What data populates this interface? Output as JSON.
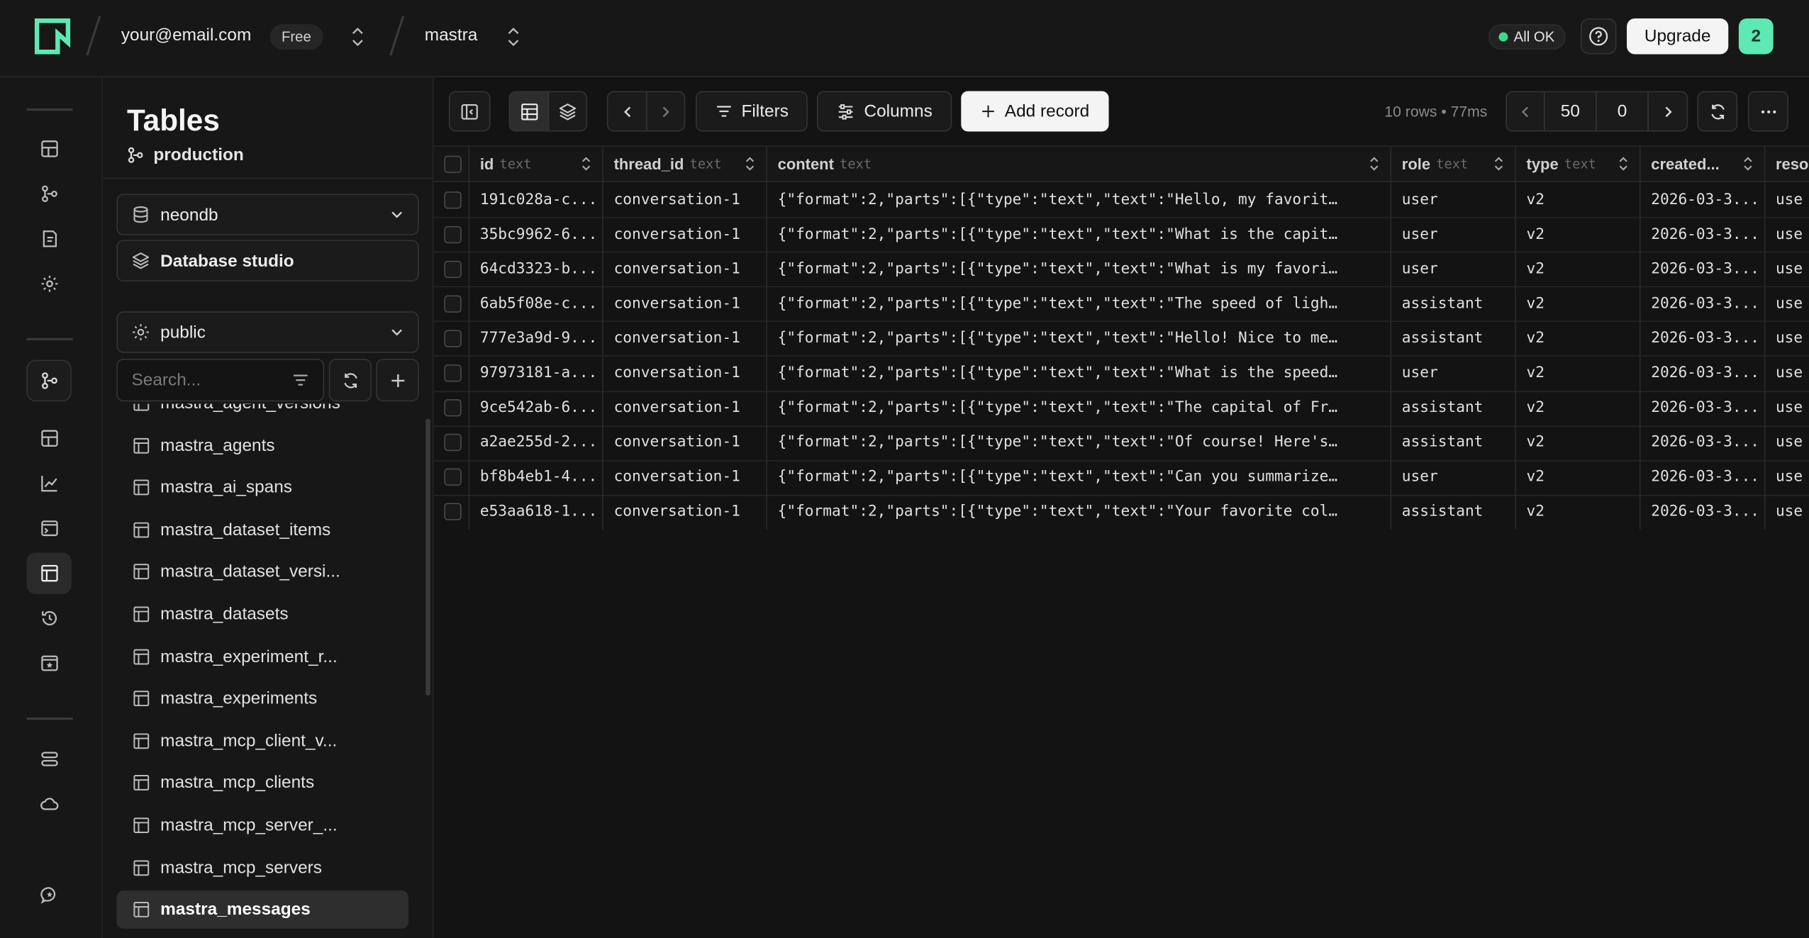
{
  "topbar": {
    "account": "your@email.com",
    "plan": "Free",
    "project": "mastra",
    "status": "All OK",
    "upgrade_label": "Upgrade",
    "notification_count": "2",
    "status_color": "#39d98a",
    "brand_color": "#5ee8b4"
  },
  "sidebar": {
    "title": "Tables",
    "branch": "production",
    "database": "neondb",
    "studio_label": "Database studio",
    "schema": "public",
    "search_placeholder": "Search...",
    "tables": [
      "mastra_agent_versions",
      "mastra_agents",
      "mastra_ai_spans",
      "mastra_dataset_items",
      "mastra_dataset_versi...",
      "mastra_datasets",
      "mastra_experiment_r...",
      "mastra_experiments",
      "mastra_mcp_client_v...",
      "mastra_mcp_clients",
      "mastra_mcp_server_...",
      "mastra_mcp_servers",
      "mastra_messages"
    ],
    "selected_table": "mastra_messages"
  },
  "toolbar": {
    "filters_label": "Filters",
    "columns_label": "Columns",
    "add_record_label": "Add record",
    "meta": "10 rows • 77ms",
    "limit": "50",
    "offset": "0"
  },
  "grid": {
    "columns": [
      {
        "name": "id",
        "type": "text"
      },
      {
        "name": "thread_id",
        "type": "text"
      },
      {
        "name": "content",
        "type": "text"
      },
      {
        "name": "role",
        "type": "text"
      },
      {
        "name": "type",
        "type": "text"
      },
      {
        "name": "created...",
        "type": ""
      },
      {
        "name": "reso",
        "type": ""
      }
    ],
    "rows": [
      [
        "191c028a-c...",
        "conversation-1",
        "{\"format\":2,\"parts\":[{\"type\":\"text\",\"text\":\"Hello, my favorit…",
        "user",
        "v2",
        "2026-03-3...",
        "use"
      ],
      [
        "35bc9962-6...",
        "conversation-1",
        "{\"format\":2,\"parts\":[{\"type\":\"text\",\"text\":\"What is the capit…",
        "user",
        "v2",
        "2026-03-3...",
        "use"
      ],
      [
        "64cd3323-b...",
        "conversation-1",
        "{\"format\":2,\"parts\":[{\"type\":\"text\",\"text\":\"What is my favori…",
        "user",
        "v2",
        "2026-03-3...",
        "use"
      ],
      [
        "6ab5f08e-c...",
        "conversation-1",
        "{\"format\":2,\"parts\":[{\"type\":\"text\",\"text\":\"The speed of ligh…",
        "assistant",
        "v2",
        "2026-03-3...",
        "use"
      ],
      [
        "777e3a9d-9...",
        "conversation-1",
        "{\"format\":2,\"parts\":[{\"type\":\"text\",\"text\":\"Hello! Nice to me…",
        "assistant",
        "v2",
        "2026-03-3...",
        "use"
      ],
      [
        "97973181-a...",
        "conversation-1",
        "{\"format\":2,\"parts\":[{\"type\":\"text\",\"text\":\"What is the speed…",
        "user",
        "v2",
        "2026-03-3...",
        "use"
      ],
      [
        "9ce542ab-6...",
        "conversation-1",
        "{\"format\":2,\"parts\":[{\"type\":\"text\",\"text\":\"The capital of Fr…",
        "assistant",
        "v2",
        "2026-03-3...",
        "use"
      ],
      [
        "a2ae255d-2...",
        "conversation-1",
        "{\"format\":2,\"parts\":[{\"type\":\"text\",\"text\":\"Of course! Here's…",
        "assistant",
        "v2",
        "2026-03-3...",
        "use"
      ],
      [
        "bf8b4eb1-4...",
        "conversation-1",
        "{\"format\":2,\"parts\":[{\"type\":\"text\",\"text\":\"Can you summarize…",
        "user",
        "v2",
        "2026-03-3...",
        "use"
      ],
      [
        "e53aa618-1...",
        "conversation-1",
        "{\"format\":2,\"parts\":[{\"type\":\"text\",\"text\":\"Your favorite col…",
        "assistant",
        "v2",
        "2026-03-3...",
        "use"
      ]
    ]
  }
}
